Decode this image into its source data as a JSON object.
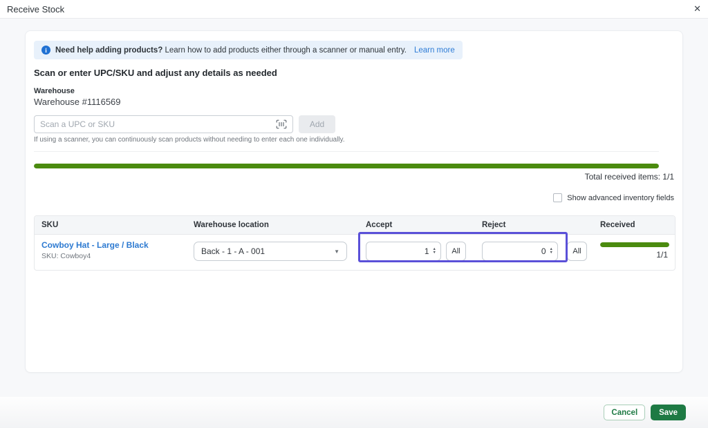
{
  "header": {
    "title": "Receive Stock",
    "close_glyph": "✕"
  },
  "banner": {
    "icon_glyph": "i",
    "bold_text": "Need help adding products?",
    "text": "Learn how to add products either through a scanner or manual entry.",
    "link_label": "Learn more"
  },
  "scan_section": {
    "heading": "Scan or enter UPC/SKU and adjust any details as needed",
    "warehouse_label": "Warehouse",
    "warehouse_value": "Warehouse #1116569",
    "scan_placeholder": "Scan a UPC or SKU",
    "add_button_label": "Add",
    "helper_text": "If using a scanner, you can continuously scan products without needing to enter each one individually."
  },
  "progress": {
    "percent": 100,
    "total_label": "Total received items: 1/1"
  },
  "options": {
    "show_advanced_label": "Show advanced inventory fields",
    "checked": false
  },
  "table": {
    "columns": [
      "SKU",
      "Warehouse location",
      "Accept",
      "Reject",
      "Received"
    ],
    "rows": [
      {
        "product_name": "Cowboy Hat - Large / Black",
        "sku_label": "SKU: Cowboy4",
        "location": "Back - 1 - A - 001",
        "accept_value": "1",
        "accept_all_label": "All",
        "reject_value": "0",
        "reject_all_label": "All",
        "received_label": "1/1",
        "received_percent": 100
      }
    ]
  },
  "icons": {
    "caret": "▼",
    "spin_up": "▲",
    "spin_down": "▼"
  },
  "footer": {
    "cancel_label": "Cancel",
    "save_label": "Save"
  },
  "colors": {
    "progress_green": "#4b8b0f",
    "save_green": "#1e7a44",
    "highlight_purple": "#5a50d8",
    "link_blue": "#2e7cd6",
    "banner_bg": "#e8f1fb"
  }
}
